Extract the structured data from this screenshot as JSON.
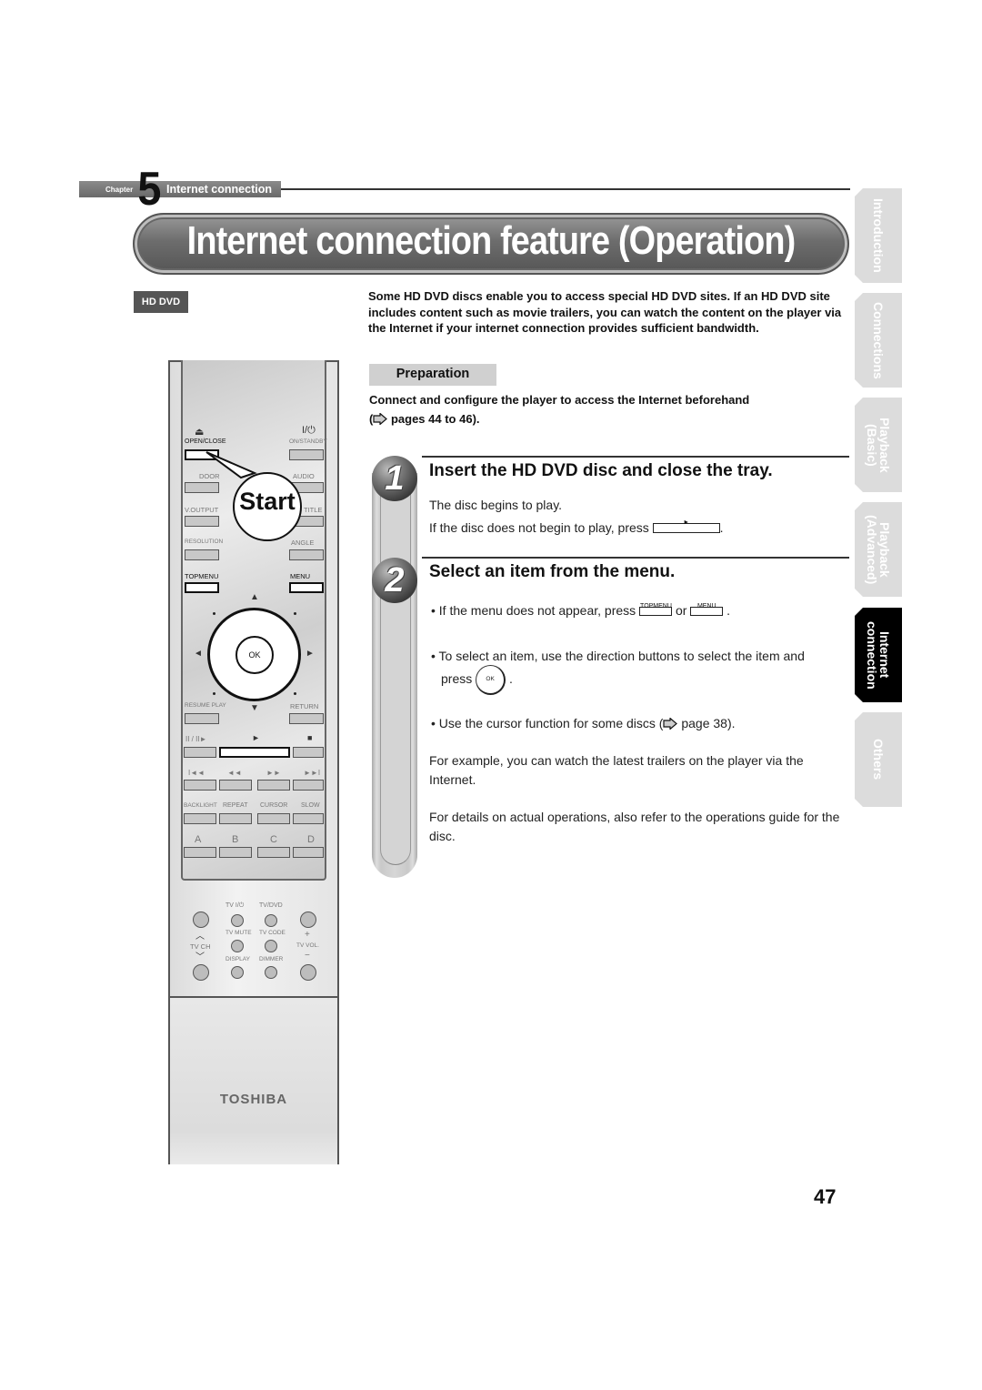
{
  "chapter": {
    "word": "Chapter",
    "number": "5",
    "title": "Internet connection"
  },
  "page_title": "Internet connection feature (Operation)",
  "badge": "HD DVD",
  "intro": "Some HD DVD discs enable you to access special HD DVD sites. If an HD DVD site includes content such as movie trailers, you can watch the content on the player via the Internet if your internet connection provides sufficient bandwidth.",
  "preparation": {
    "label": "Preparation",
    "text": "Connect and configure the player to access the Internet beforehand",
    "ref_open": "(",
    "ref_text": "pages 44 to 46)."
  },
  "steps": [
    {
      "number": "1",
      "heading": "Insert the HD DVD disc and close the tray.",
      "line1": "The disc begins to play.",
      "line2_pre": "If the disc does not begin to play, press",
      "line2_button_symbol": "►",
      "line2_post": "."
    },
    {
      "number": "2",
      "heading": "Select an item from the menu.",
      "bullet1_pre": "• If the menu does not appear, press",
      "bullet1_btn1": "TOPMENU",
      "bullet1_or": "or",
      "bullet1_btn2": "MENU",
      "bullet1_post": ".",
      "bullet2_line1": "• To select an item, use the direction buttons to select the item and",
      "bullet2_press": "press",
      "bullet2_ok": "OK",
      "bullet2_post": ".",
      "bullet3_pre": "• Use the cursor function for some discs (",
      "bullet3_post": "page 38).",
      "para1": "For example, you can watch the latest trailers on the player via the Internet.",
      "para2": "For details on actual operations, also refer to the operations guide for the disc."
    }
  ],
  "side_tabs": [
    {
      "label": "Introduction",
      "active": false
    },
    {
      "label": "Connections",
      "active": false
    },
    {
      "label": "Playback (Basic)",
      "active": false
    },
    {
      "label": "Playback (Advanced)",
      "active": false
    },
    {
      "label": "Internet connection",
      "active": true
    },
    {
      "label": "Others",
      "active": false
    }
  ],
  "remote": {
    "callout": "Start",
    "labels": {
      "eject_symbol": "⏏",
      "open_close": "OPEN/CLOSE",
      "power_symbol": "I/⏻",
      "on_standby": "ON/STANDBY",
      "door": "DOOR",
      "audio": "AUDIO",
      "v_output": "V.OUTPUT",
      "title": "TITLE",
      "resolution": "RESOLUTION",
      "angle": "ANGLE",
      "topmenu": "TOPMENU",
      "menu": "MENU",
      "up": "▲",
      "down": "▼",
      "left": "◄",
      "right": "►",
      "ok": "OK",
      "resume_play": "RESUME PLAY",
      "return": "RETURN",
      "pause_step": "II / II►",
      "play": "►",
      "stop": "■",
      "skip_back": "I◄◄",
      "rewind": "◄◄",
      "fast_forward": "►►",
      "skip_forward": "►►I",
      "backlight": "BACKLIGHT",
      "repeat": "REPEAT",
      "cursor": "CURSOR",
      "slow": "SLOW",
      "a": "A",
      "b": "B",
      "c": "C",
      "d": "D",
      "tv_power": "TV  I/⏻",
      "tv_dvd": "TV/DVD",
      "tv_mute": "TV MUTE",
      "tv_code": "TV CODE",
      "tv_ch_up": "︿",
      "tv_ch": "TV CH",
      "tv_ch_down": "﹀",
      "tv_vol_plus": "+",
      "tv_vol": "TV VOL.",
      "tv_vol_minus": "−",
      "display": "DISPLAY",
      "dimmer": "DIMMER"
    },
    "brand": "TOSHIBA"
  },
  "page_number": "47"
}
